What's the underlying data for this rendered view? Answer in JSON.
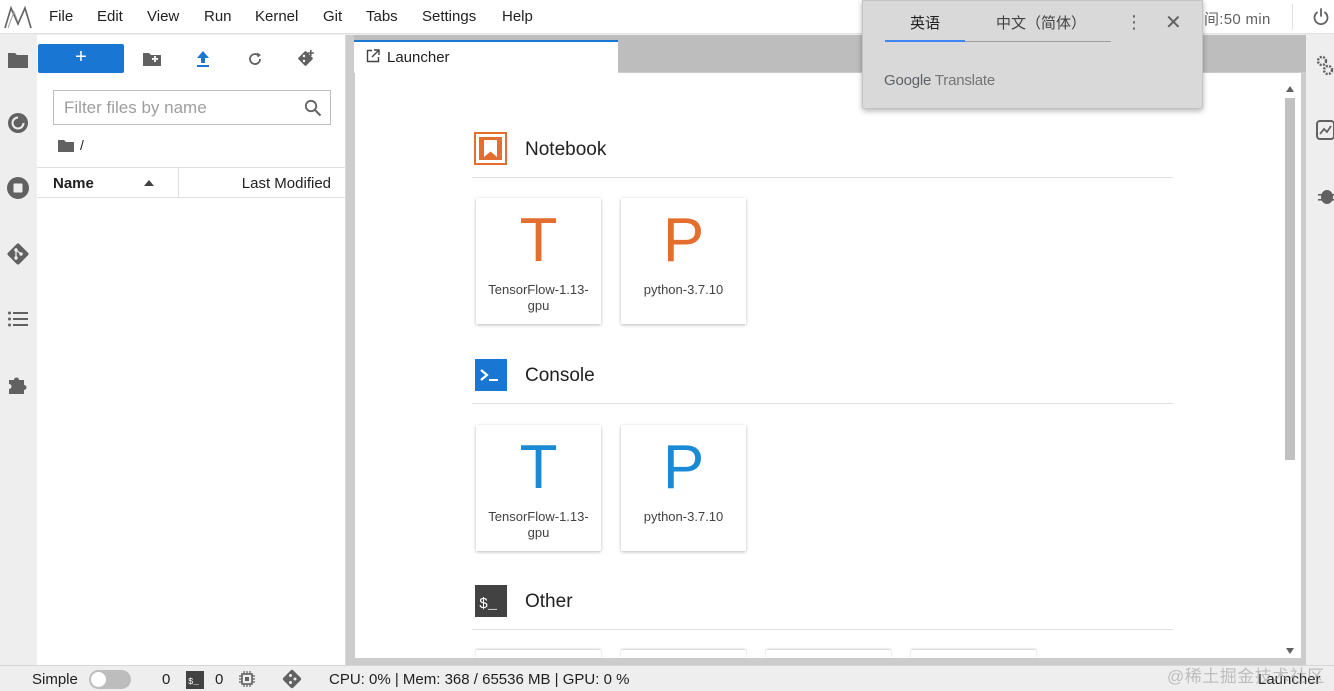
{
  "menubar": {
    "items": [
      "File",
      "Edit",
      "View",
      "Run",
      "Kernel",
      "Git",
      "Tabs",
      "Settings",
      "Help"
    ],
    "timer_text": "间:50 min"
  },
  "file_browser": {
    "new_button_label": "+",
    "filter_placeholder": "Filter files by name",
    "breadcrumb_root": "/",
    "columns": {
      "name": "Name",
      "modified": "Last Modified"
    }
  },
  "tabs": [
    {
      "label": "Launcher",
      "icon": "launch-icon",
      "active": true
    }
  ],
  "launcher": {
    "sections": [
      {
        "title": "Notebook",
        "icon": "notebook-icon",
        "color": "#e46e2e",
        "cards": [
          {
            "letter": "T",
            "label": "TensorFlow-1.13-gpu"
          },
          {
            "letter": "P",
            "label": "python-3.7.10"
          }
        ]
      },
      {
        "title": "Console",
        "icon": "console-icon",
        "color": "#1976d2",
        "cards": [
          {
            "letter": "T",
            "label": "TensorFlow-1.13-gpu"
          },
          {
            "letter": "P",
            "label": "python-3.7.10"
          }
        ]
      },
      {
        "title": "Other",
        "icon": "terminal-icon",
        "color": "#424242",
        "cards": []
      }
    ]
  },
  "translate_popup": {
    "tab_source": "英语",
    "tab_target": "中文（简体）",
    "brand_google": "Google",
    "brand_translate": "Translate"
  },
  "statusbar": {
    "mode_label": "Simple",
    "kernel_count": "0",
    "terminal_count": "0",
    "resources": "CPU: 0% | Mem: 368 / 65536 MB | GPU: 0 %",
    "right_label": "Launcher",
    "watermark": "@稀土掘金技术社区"
  },
  "colors": {
    "accent": "#1976d2",
    "notebook": "#e46e2e",
    "console": "#1976d2"
  }
}
